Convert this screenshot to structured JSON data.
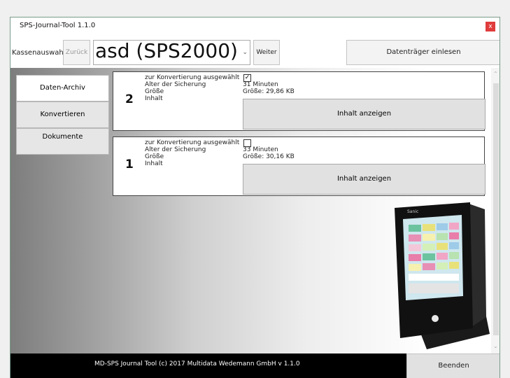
{
  "window": {
    "title": "SPS-Journal-Tool 1.1.0",
    "close": "x"
  },
  "toolbar": {
    "kasse_label": "Kassenauswahl",
    "zurueck": "Zurück",
    "combo_value": "asd (SPS2000)",
    "weiter": "Weiter",
    "datentraeger": "Datenträger einlesen"
  },
  "nav": {
    "items": [
      {
        "label": "Daten-Archiv",
        "active": true
      },
      {
        "label": "Konvertieren",
        "active": false
      },
      {
        "label": "Dokumente",
        "active": false
      }
    ]
  },
  "archives": [
    {
      "number": "2",
      "selected": true,
      "labels": {
        "selected": "zur Konvertierung ausgewählt",
        "age": "Alter der Sicherung",
        "size": "Größe",
        "content": "Inhalt"
      },
      "age": "31 Minuten",
      "size": "Größe: 29,86 KB",
      "button": "Inhalt anzeigen"
    },
    {
      "number": "1",
      "selected": false,
      "labels": {
        "selected": "zur Konvertierung ausgewählt",
        "age": "Alter der Sicherung",
        "size": "Größe",
        "content": "Inhalt"
      },
      "age": "33 Minuten",
      "size": "Größe: 30,16 KB",
      "button": "Inhalt anzeigen"
    }
  ],
  "footer": {
    "text": "MD-SPS Journal Tool (c) 2017 Multidata Wedemann GmbH v 1.1.0",
    "beenden": "Beenden"
  },
  "image": {
    "brand": "Sanic"
  }
}
